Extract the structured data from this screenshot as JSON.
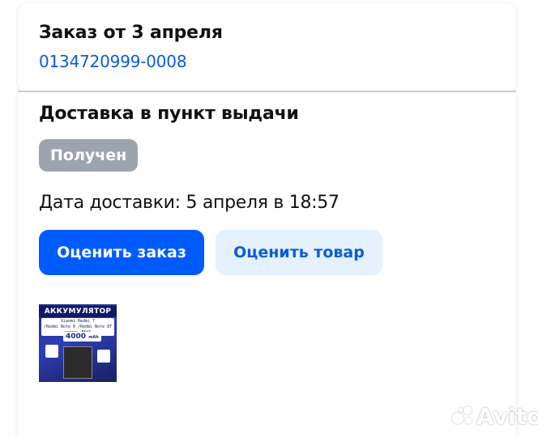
{
  "order": {
    "title": "Заказ от 3 апреля",
    "number": "0134720999-0008"
  },
  "delivery": {
    "type": "Доставка в пункт выдачи",
    "status": "Получен",
    "date": "Дата доставки: 5 апреля в 18:57"
  },
  "actions": {
    "rate_order": "Оценить заказ",
    "rate_product": "Оценить товар"
  },
  "product_image": {
    "title": "АККУМУЛЯТОР",
    "compat_line1": "Xiaomi Redmi 7",
    "compat_line2": "/Redmi Note 8 /Redmi Note 8T",
    "model": "модель BN46",
    "capacity": "4000",
    "unit": "mAh"
  },
  "watermark": {
    "text": "Avito"
  },
  "colors": {
    "accent": "#005bff",
    "link": "#0a5cd6",
    "secondary_button_bg": "#e5f1ff",
    "status_badge_bg": "#9ea4ad"
  }
}
